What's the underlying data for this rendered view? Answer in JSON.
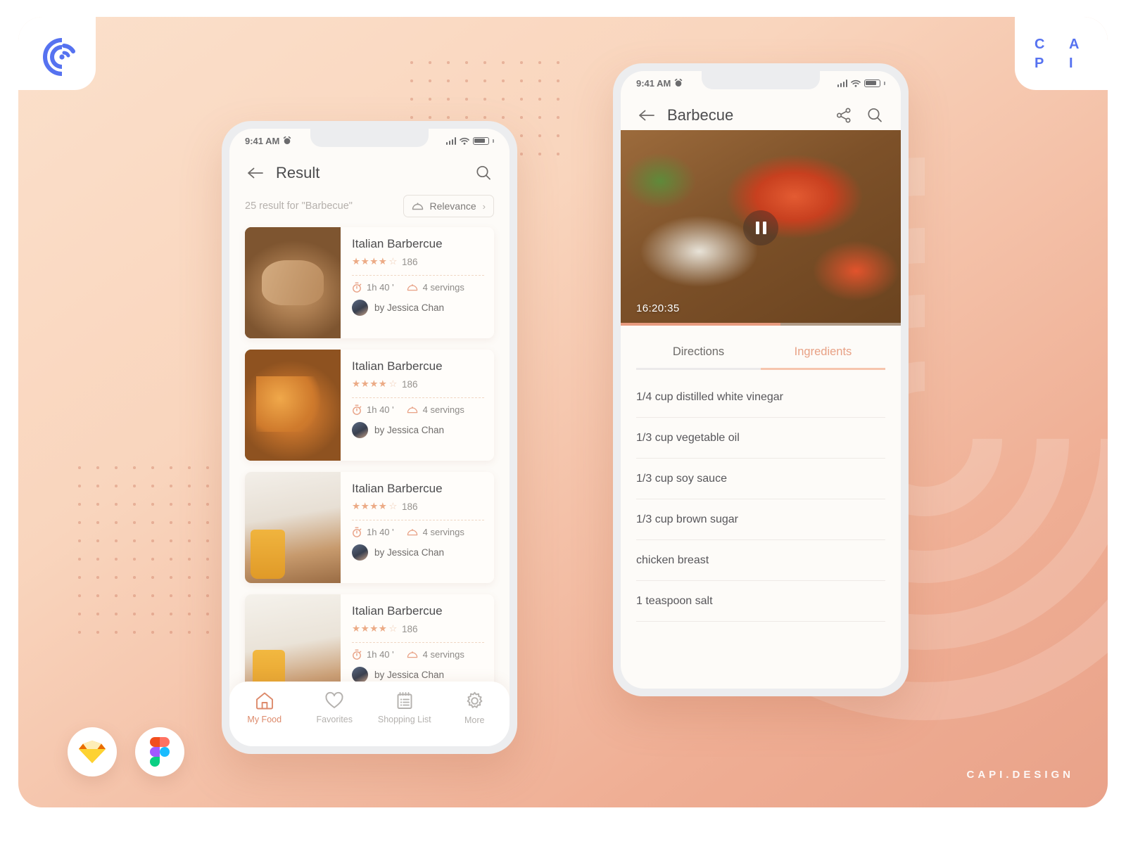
{
  "brand": {
    "logo_icon": "capi-concentric-c-logo",
    "wordmark_letters": [
      "C",
      "A",
      "P",
      "I"
    ],
    "watermark": "CAPI.DESIGN",
    "accent_blue": "#5672f0",
    "accent_salmon": "#e8a185"
  },
  "tools": [
    {
      "name": "sketch-logo",
      "label": "Sketch"
    },
    {
      "name": "figma-logo",
      "label": "Figma"
    }
  ],
  "phone_left": {
    "status_bar": {
      "time": "9:41 AM",
      "alarm_icon": "alarm-clock-icon",
      "signal_icon": "cellular-signal-icon",
      "wifi_icon": "wifi-icon",
      "battery_icon": "battery-icon"
    },
    "appbar": {
      "back_icon": "arrow-left-icon",
      "title": "Result",
      "search_icon": "search-icon"
    },
    "result_count": "25 result for \"Barbecue\"",
    "sort": {
      "icon": "cloche-icon",
      "label": "Relevance",
      "chevron": "›"
    },
    "cards": [
      {
        "title": "Italian Barbercue",
        "stars": 4,
        "max_stars": 5,
        "rating_count": "186",
        "time": "1h 40 '",
        "servings": "4 servings",
        "author": "by Jessica Chan",
        "time_icon": "timer-icon",
        "servings_icon": "cloche-icon"
      },
      {
        "title": "Italian Barbercue",
        "stars": 4,
        "max_stars": 5,
        "rating_count": "186",
        "time": "1h 40 '",
        "servings": "4 servings",
        "author": "by Jessica Chan",
        "time_icon": "timer-icon",
        "servings_icon": "cloche-icon"
      },
      {
        "title": "Italian Barbercue",
        "stars": 4,
        "max_stars": 5,
        "rating_count": "186",
        "time": "1h 40 '",
        "servings": "4 servings",
        "author": "by Jessica Chan",
        "time_icon": "timer-icon",
        "servings_icon": "cloche-icon"
      },
      {
        "title": "Italian Barbercue",
        "stars": 4,
        "max_stars": 5,
        "rating_count": "186",
        "time": "1h 40 '",
        "servings": "4 servings",
        "author": "by Jessica Chan",
        "time_icon": "timer-icon",
        "servings_icon": "cloche-icon"
      }
    ],
    "bottom_nav": [
      {
        "label": "My Food",
        "icon": "home-icon",
        "active": true
      },
      {
        "label": "Favorites",
        "icon": "heart-icon",
        "active": false
      },
      {
        "label": "Shopping List",
        "icon": "notepad-icon",
        "active": false
      },
      {
        "label": "More",
        "icon": "gear-icon",
        "active": false
      }
    ]
  },
  "phone_right": {
    "status_bar": {
      "time": "9:41 AM",
      "alarm_icon": "alarm-clock-icon",
      "signal_icon": "cellular-signal-icon",
      "wifi_icon": "wifi-icon",
      "battery_icon": "battery-icon"
    },
    "appbar": {
      "back_icon": "arrow-left-icon",
      "title": "Barbecue",
      "share_icon": "share-icon",
      "search_icon": "search-icon"
    },
    "video": {
      "timecode": "16:20:35",
      "control_icon": "pause-icon",
      "progress_percent": 57
    },
    "tabs": [
      {
        "label": "Directions",
        "active": false
      },
      {
        "label": "Ingredients",
        "active": true
      }
    ],
    "ingredients": [
      "1/4 cup distilled white vinegar",
      "1/3 cup vegetable oil",
      "1/3 cup soy sauce",
      "1/3 cup brown sugar",
      "chicken breast",
      "1 teaspoon salt"
    ]
  }
}
